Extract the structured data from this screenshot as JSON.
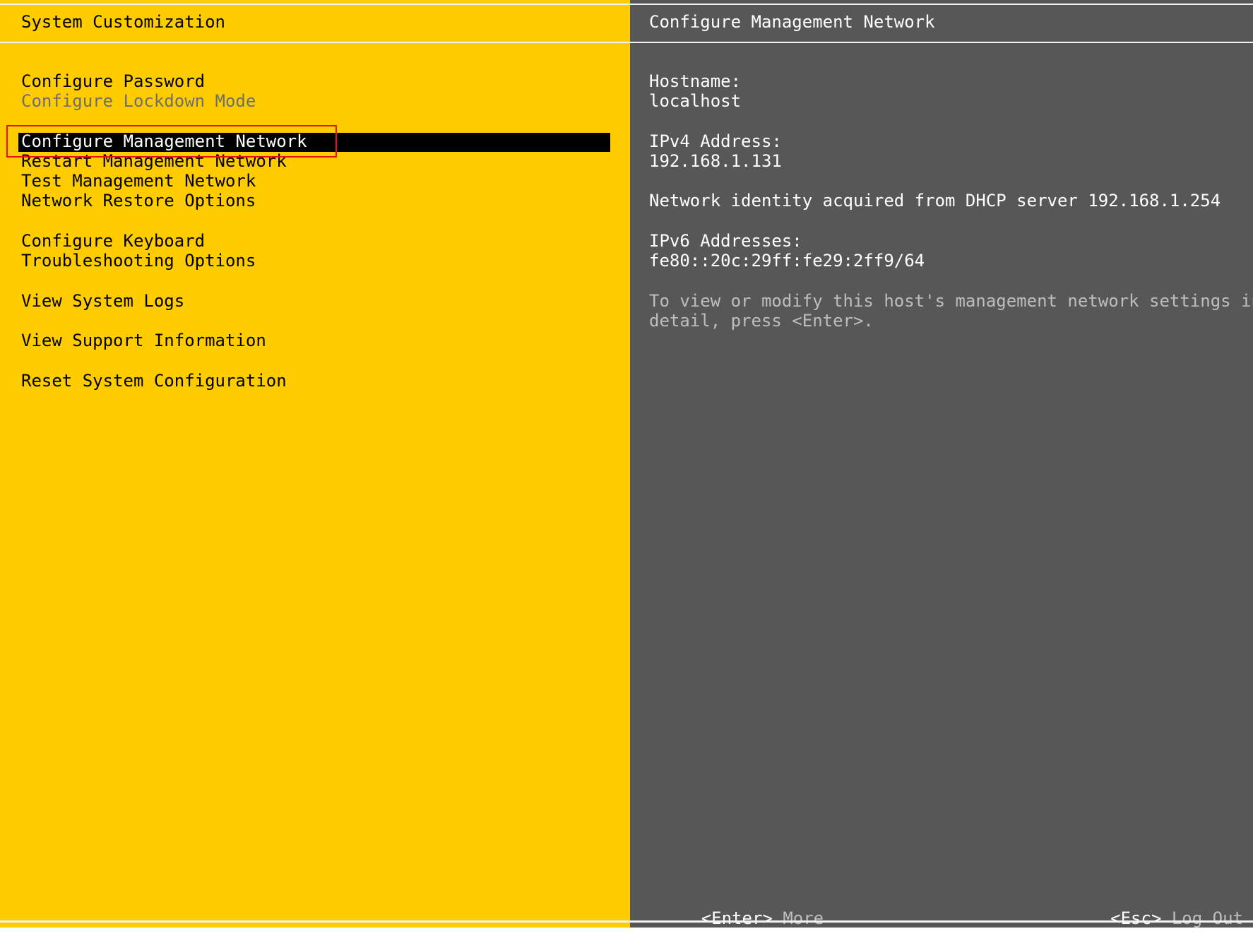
{
  "left_panel": {
    "title": "System Customization",
    "menu": {
      "configure_password": "Configure Password",
      "configure_lockdown_mode": "Configure Lockdown Mode",
      "configure_management_network": "Configure Management Network",
      "restart_management_network": "Restart Management Network",
      "test_management_network": "Test Management Network",
      "network_restore_options": "Network Restore Options",
      "configure_keyboard": "Configure Keyboard",
      "troubleshooting_options": "Troubleshooting Options",
      "view_system_logs": "View System Logs",
      "view_support_information": "View Support Information",
      "reset_system_configuration": "Reset System Configuration"
    },
    "selected_item": "Configure Management Network"
  },
  "right_panel": {
    "title": "Configure Management Network",
    "hostname_label": "Hostname:",
    "hostname_value": "localhost",
    "ipv4_label": "IPv4 Address:",
    "ipv4_value": "192.168.1.131",
    "dhcp_note": "Network identity acquired from DHCP server 192.168.1.254",
    "ipv6_label": "IPv6 Addresses:",
    "ipv6_value": "fe80::20c:29ff:fe29:2ff9/64",
    "help_line1": "To view or modify this host's management network settings in",
    "help_line2": "detail, press <Enter>."
  },
  "footer": {
    "enter_key": "<Enter>",
    "enter_action": "More",
    "esc_key": "<Esc>",
    "esc_action": "Log Out"
  },
  "colors": {
    "left_background": "#ffcc00",
    "right_background": "#575757",
    "selection_background": "#000000",
    "disabled_text": "#6e6e6e",
    "muted_text": "#bdbdbd",
    "highlight_border": "#e8101e"
  }
}
